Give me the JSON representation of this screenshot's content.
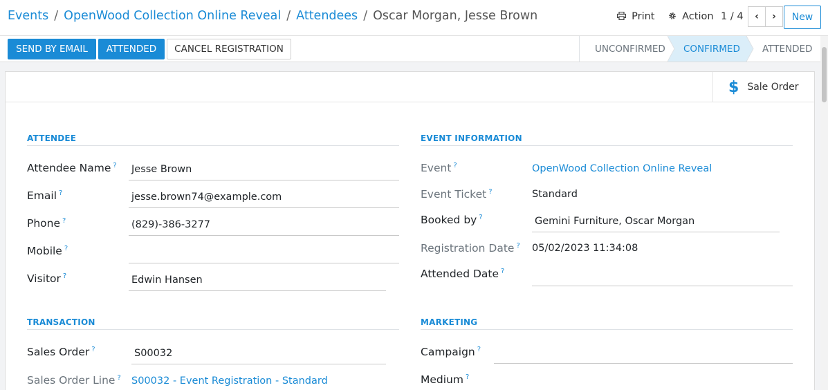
{
  "breadcrumb": {
    "events": "Events",
    "event": "OpenWood Collection Online Reveal",
    "attendees": "Attendees",
    "current": "Oscar Morgan, Jesse Brown"
  },
  "toolbar": {
    "print_label": "Print",
    "action_label": "Action",
    "pager": "1 / 4",
    "prev_glyph": "‹",
    "next_glyph": "›",
    "new_label": "New"
  },
  "statusbar": {
    "send_email_label": "SEND BY EMAIL",
    "attended_label": "ATTENDED",
    "cancel_label": "CANCEL REGISTRATION",
    "stages": [
      {
        "label": "UNCONFIRMED",
        "active": false
      },
      {
        "label": "CONFIRMED",
        "active": true
      },
      {
        "label": "ATTENDED",
        "active": false
      }
    ]
  },
  "smart_buttons": {
    "sale_order_label": "Sale Order"
  },
  "sections": {
    "attendee": {
      "title": "ATTENDEE",
      "name_label": "Attendee Name",
      "name_value": "Jesse Brown",
      "email_label": "Email",
      "email_value": "jesse.brown74@example.com",
      "phone_label": "Phone",
      "phone_value": "(829)-386-3277",
      "mobile_label": "Mobile",
      "mobile_value": "",
      "visitor_label": "Visitor",
      "visitor_value": "Edwin Hansen"
    },
    "event_info": {
      "title": "EVENT INFORMATION",
      "event_label": "Event",
      "event_value": "OpenWood Collection Online Reveal",
      "ticket_label": "Event Ticket",
      "ticket_value": "Standard",
      "booked_label": "Booked by",
      "booked_value": "Gemini Furniture, Oscar Morgan",
      "reg_date_label": "Registration Date",
      "reg_date_value": "05/02/2023 11:34:08",
      "attended_date_label": "Attended Date",
      "attended_date_value": ""
    },
    "transaction": {
      "title": "TRANSACTION",
      "so_label": "Sales Order",
      "so_value": "S00032",
      "sol_label": "Sales Order Line",
      "sol_value": "S00032 - Event Registration - Standard"
    },
    "marketing": {
      "title": "MARKETING",
      "campaign_label": "Campaign",
      "campaign_value": "",
      "medium_label": "Medium"
    }
  },
  "help_marker": "?",
  "colors": {
    "accent": "#1a8bd6",
    "active_stage_bg": "#dbeef9"
  }
}
